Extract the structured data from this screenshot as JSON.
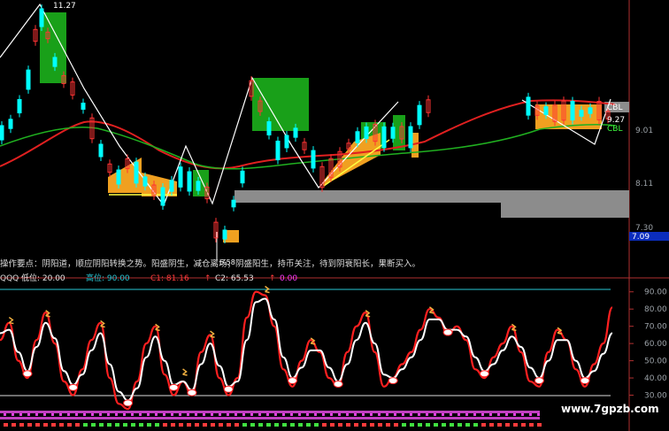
{
  "top_panel": {
    "high_label": "11.27",
    "low_label": "6.58",
    "indicator_labels": [
      "CBL",
      "CBL"
    ],
    "price_readout": "9.27",
    "current_price_tag": "7.09",
    "axis_ticks": [
      "9.01",
      "8.11",
      "7.30"
    ],
    "comment_text": "操作要点：阴阳道，顺应阴阳转换之势。阳盛阴生，减仓离场；阴盛阳生，持币关注，待到阴衰阳长，果断买入。"
  },
  "bottom_panel": {
    "indicator_name": "QQQ",
    "params": [
      {
        "label": "低位:",
        "value": "20.00",
        "color": "#e6e6e6"
      },
      {
        "label": "高位:",
        "value": "90.00",
        "color": "#29c7d6"
      },
      {
        "label": "C1:",
        "value": "81.16",
        "color": "#ff3b3b"
      },
      {
        "label": "C2:",
        "value": "65.53",
        "color": "#e6e6e6"
      },
      {
        "label": "",
        "value": "0.00",
        "color": "#ff3bff"
      }
    ],
    "axis_ticks": [
      "90.00",
      "80.00",
      "70.00",
      "60.00",
      "50.00",
      "40.00",
      "30.00"
    ],
    "y_range": [
      20,
      95
    ]
  },
  "watermark": "www.7gpzb.com",
  "colors": {
    "up": "#ff3333",
    "down": "#00ffff",
    "ma_red": "#e02020",
    "ma_green": "#20b020",
    "fill_green": "#19a019",
    "fill_orange": "#f0a020",
    "gray_band": "#8c8c8c"
  },
  "chart_data": [
    {
      "type": "candlestick",
      "title": "",
      "series": [
        {
          "name": "",
          "values": []
        }
      ],
      "annotations": [
        "11.27",
        "6.58",
        "CBL",
        "9.27",
        "7.09"
      ]
    },
    {
      "type": "line",
      "title": "QQQ",
      "series": [
        {
          "name": "C1",
          "values": [
            62,
            72,
            50,
            40,
            62,
            78,
            60,
            38,
            30,
            45,
            62,
            72,
            40,
            25,
            22,
            38,
            60,
            70,
            42,
            30,
            38,
            30,
            55,
            65,
            40,
            30,
            40,
            75,
            90,
            88,
            70,
            45,
            35,
            50,
            62,
            55,
            40,
            35,
            55,
            70,
            78,
            55,
            35,
            40,
            48,
            55,
            68,
            80,
            75,
            65,
            70,
            62,
            45,
            40,
            52,
            60,
            70,
            55,
            38,
            35,
            55,
            68,
            62,
            45,
            35,
            48,
            60,
            81
          ]
        },
        {
          "name": "C2",
          "values": [
            66,
            68,
            55,
            44,
            58,
            72,
            63,
            44,
            36,
            42,
            56,
            66,
            48,
            32,
            27,
            34,
            52,
            64,
            50,
            36,
            38,
            33,
            48,
            60,
            47,
            35,
            38,
            62,
            84,
            86,
            74,
            52,
            40,
            46,
            56,
            56,
            46,
            38,
            48,
            62,
            72,
            60,
            42,
            40,
            45,
            52,
            62,
            74,
            74,
            68,
            68,
            64,
            52,
            44,
            48,
            56,
            64,
            58,
            46,
            40,
            50,
            62,
            62,
            50,
            40,
            44,
            54,
            66
          ]
        }
      ],
      "ylim": [
        20,
        95
      ],
      "reference_lines": [
        90,
        30
      ]
    }
  ]
}
